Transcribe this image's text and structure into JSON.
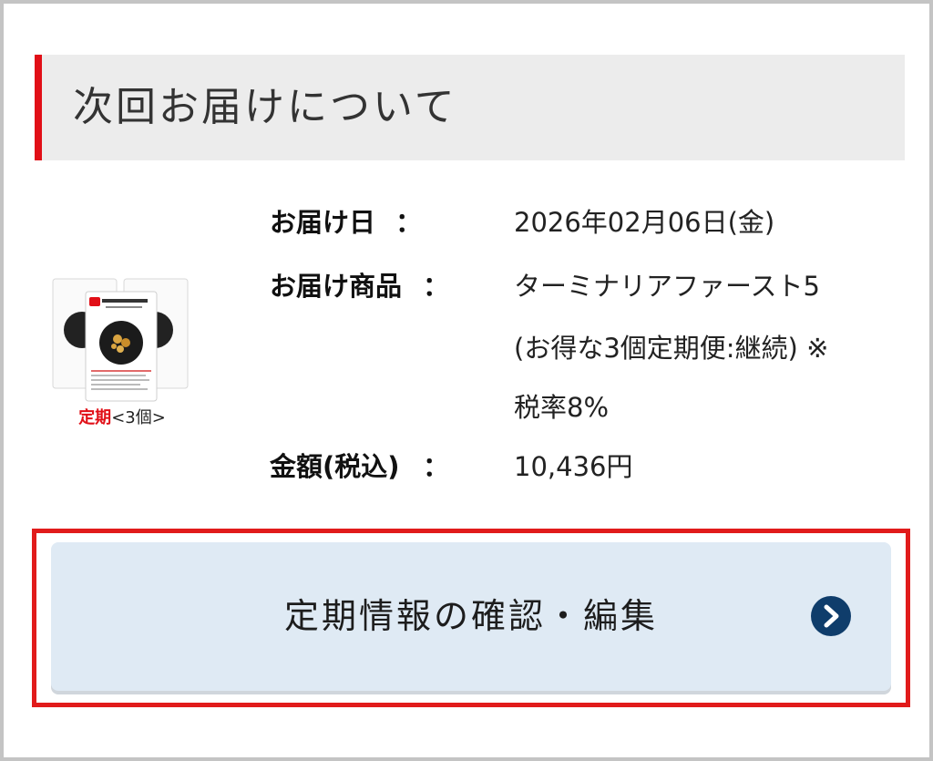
{
  "section": {
    "title": "次回お届けについて"
  },
  "product": {
    "image_alt": "ターミナリアファースト PROFESSIONAL",
    "caption_accent": "定期",
    "caption_rest": "<3個>"
  },
  "delivery": {
    "date_label": "お届け日",
    "date_value": "2026年02月06日(金)",
    "item_label": "お届け商品",
    "item_lines": [
      "ターミナリアファースト5",
      "(お得な3個定期便:継続) ※",
      "税率8%"
    ],
    "price_label": "金額(税込)",
    "price_value": "10,436円",
    "colon": "："
  },
  "action": {
    "label": "定期情報の確認・編集",
    "icon": "chevron-right-circle-icon"
  },
  "colors": {
    "accent_red": "#e10f17",
    "button_bg": "#dfeaf4",
    "icon_navy": "#0f3d6b"
  }
}
